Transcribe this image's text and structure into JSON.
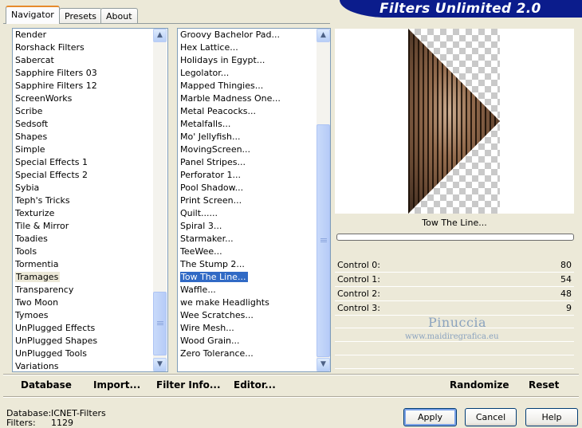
{
  "tabs": [
    {
      "label": "Navigator"
    },
    {
      "label": "Presets"
    },
    {
      "label": "About"
    }
  ],
  "banner_title": "Filters Unlimited 2.0",
  "categories": [
    "Render",
    "Rorshack Filters",
    "Sabercat",
    "Sapphire Filters 03",
    "Sapphire Filters 12",
    "ScreenWorks",
    "Scribe",
    "Sedsoft",
    "Shapes",
    "Simple",
    "Special Effects 1",
    "Special Effects 2",
    "Sybia",
    "Teph's Tricks",
    "Texturize",
    "Tile & Mirror",
    "Toadies",
    "Tools",
    "Tormentia",
    "Tramages",
    "Transparency",
    "Two Moon",
    "Tymoes",
    "UnPlugged Effects",
    "UnPlugged Shapes",
    "UnPlugged Tools",
    "Variations"
  ],
  "selected_category": "Tramages",
  "filters": [
    "Groovy Bachelor Pad...",
    "Hex Lattice...",
    "Holidays in Egypt...",
    "Legolator...",
    "Mapped Thingies...",
    "Marble Madness One...",
    "Metal Peacocks...",
    "Metalfalls...",
    "Mo' Jellyfish...",
    "MovingScreen...",
    "Panel Stripes...",
    "Perforator 1...",
    "Pool Shadow...",
    "Print Screen...",
    "Quilt......",
    "Spiral 3...",
    "Starmaker...",
    "TeeWee...",
    "The Stump 2...",
    "Tow The Line...",
    "Waffle...",
    "we make Headlights",
    "Wee Scratches...",
    "Wire Mesh...",
    "Wood Grain...",
    "Zero Tolerance..."
  ],
  "selected_filter": "Tow The Line...",
  "preview": {
    "filter_name": "Tow The Line...",
    "progress": 0
  },
  "controls": [
    {
      "label": "Control 0:",
      "value": "80"
    },
    {
      "label": "Control 1:",
      "value": "54"
    },
    {
      "label": "Control 2:",
      "value": "48"
    },
    {
      "label": "Control 3:",
      "value": "9"
    }
  ],
  "watermark": {
    "name": "Pinuccia",
    "url": "www.maidiregrafica.eu"
  },
  "toolbar": {
    "database": "Database",
    "import": "Import...",
    "filter_info": "Filter Info...",
    "editor": "Editor...",
    "randomize": "Randomize",
    "reset": "Reset"
  },
  "status": {
    "database_label": "Database:",
    "database_value": "ICNET-Filters",
    "filters_label": "Filters:",
    "filters_value": "1129"
  },
  "buttons": {
    "apply": "Apply",
    "cancel": "Cancel",
    "help": "Help"
  },
  "colors": {
    "banner": "#0b1c8c",
    "selection": "#316ac5",
    "window": "#ece9d8",
    "tab_accent": "#e68b2c"
  }
}
